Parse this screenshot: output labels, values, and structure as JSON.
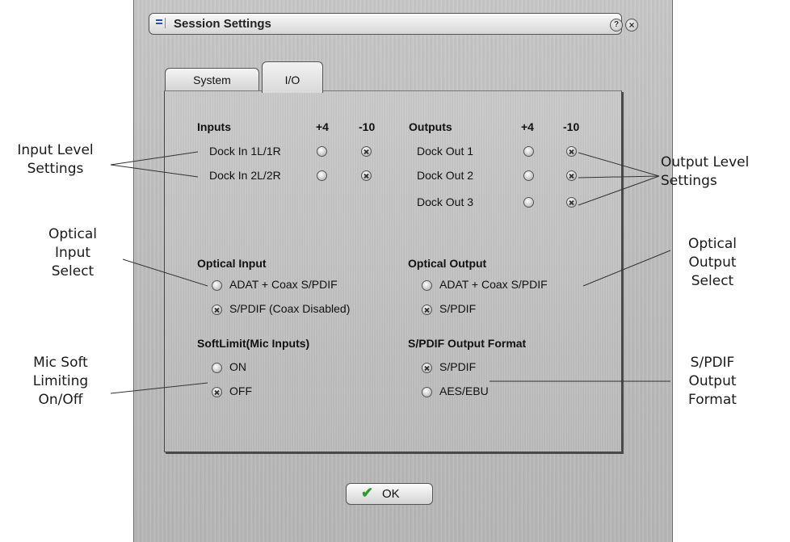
{
  "window": {
    "title": "Session Settings",
    "help_glyph": "?",
    "close_glyph": "×",
    "icons": [
      "menu-icon",
      "help-icon",
      "close-icon"
    ]
  },
  "tabs": [
    {
      "label": "System",
      "selected": false
    },
    {
      "label": "I/O",
      "selected": true
    }
  ],
  "inputs": {
    "header": "Inputs",
    "col_plus4": "+4",
    "col_minus10": "-10",
    "rows": [
      {
        "label": "Dock In 1L/1R",
        "selected": "-10"
      },
      {
        "label": "Dock In 2L/2R",
        "selected": "-10"
      }
    ]
  },
  "outputs": {
    "header": "Outputs",
    "col_plus4": "+4",
    "col_minus10": "-10",
    "rows": [
      {
        "label": "Dock Out 1",
        "selected": "-10"
      },
      {
        "label": "Dock Out 2",
        "selected": "-10"
      },
      {
        "label": "Dock Out 3",
        "selected": "-10"
      }
    ]
  },
  "optical_input": {
    "header": "Optical Input",
    "options": [
      "ADAT + Coax S/PDIF",
      "S/PDIF (Coax Disabled)"
    ],
    "selected_index": 1
  },
  "optical_output": {
    "header": "Optical Output",
    "options": [
      "ADAT + Coax S/PDIF",
      "S/PDIF"
    ],
    "selected_index": 1
  },
  "softlimit": {
    "header": "SoftLimit(Mic Inputs)",
    "options": [
      "ON",
      "OFF"
    ],
    "selected_index": 1
  },
  "spdif_format": {
    "header": "S/PDIF Output Format",
    "options": [
      "S/PDIF",
      "AES/EBU"
    ],
    "selected_index": 0
  },
  "ok_button": {
    "label": "OK",
    "icon": "checkmark-icon"
  },
  "callouts": {
    "input_level": [
      "Input Level",
      "Settings"
    ],
    "output_level": [
      "Output Level",
      "Settings"
    ],
    "optical_input_select": [
      "Optical",
      "Input",
      "Select"
    ],
    "optical_output_select": [
      "Optical",
      "Output",
      "Select"
    ],
    "mic_soft_limiting": [
      "Mic Soft",
      "Limiting",
      "On/Off"
    ],
    "spdif_output_format": [
      "S/PDIF",
      "Output",
      "Format"
    ]
  }
}
